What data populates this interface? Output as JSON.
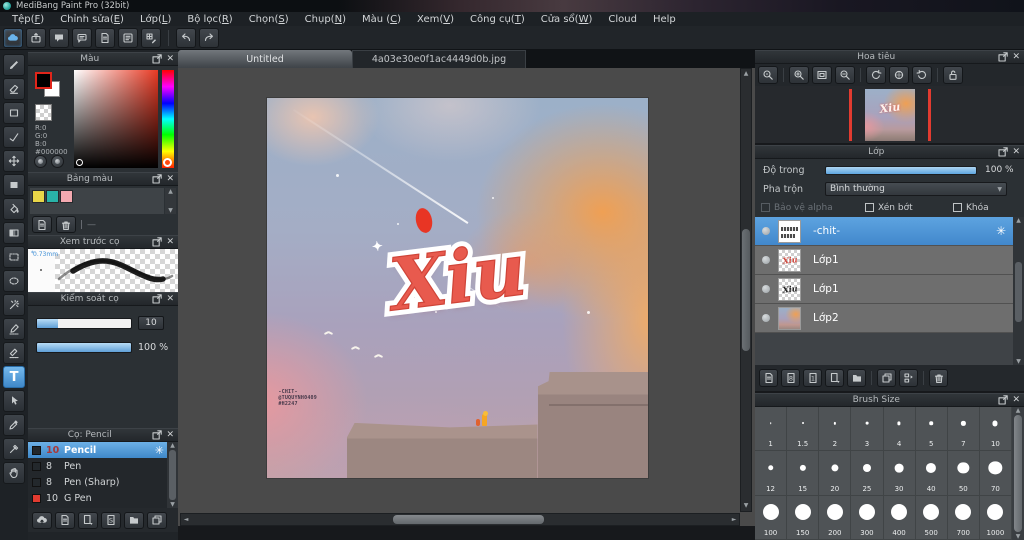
{
  "window": {
    "title": "MediBang Paint Pro (32bit)"
  },
  "menu_bar": {
    "items": [
      "Tệp(F)",
      "Chỉnh sửa(E)",
      "Lớp(L)",
      "Bộ lọc(R)",
      "Chọn(S)",
      "Chụp(N)",
      "Màu (C)",
      "Xem(V)",
      "Công cụ(T)",
      "Cửa sổ(W)",
      "Cloud",
      "Help"
    ]
  },
  "toolbar": {
    "buttons": [
      {
        "name": "cloud-sync-button",
        "icon": "cloud",
        "accent": true
      },
      {
        "name": "export-button",
        "icon": "export"
      },
      {
        "name": "comment-button",
        "icon": "comment"
      },
      {
        "name": "chat-button",
        "icon": "chat"
      },
      {
        "name": "document-button",
        "icon": "doc"
      },
      {
        "name": "material-list-button",
        "icon": "list"
      },
      {
        "name": "grid-edit-button",
        "icon": "gridpen"
      }
    ],
    "history": [
      {
        "name": "undo-button",
        "icon": "undo"
      },
      {
        "name": "redo-button",
        "icon": "redo"
      }
    ]
  },
  "tool_strip": [
    {
      "name": "brush-tool",
      "icon": "brush"
    },
    {
      "name": "eraser-tool",
      "icon": "eraser"
    },
    {
      "name": "shape-brush-tool",
      "icon": "rect"
    },
    {
      "name": "snap-tool",
      "icon": "check"
    },
    {
      "name": "move-tool",
      "icon": "move"
    },
    {
      "name": "fill-shape-tool",
      "icon": "fillrect"
    },
    {
      "name": "bucket-tool",
      "icon": "bucket"
    },
    {
      "name": "gradient-tool",
      "icon": "gradient"
    },
    {
      "name": "select-tool",
      "icon": "select"
    },
    {
      "name": "lasso-tool",
      "icon": "lasso"
    },
    {
      "name": "magic-wand-tool",
      "icon": "wand"
    },
    {
      "name": "select-pen-tool",
      "icon": "selpen"
    },
    {
      "name": "select-eraser-tool",
      "icon": "seleraser"
    },
    {
      "name": "text-tool",
      "icon": "text",
      "active": true
    },
    {
      "name": "operation-tool",
      "icon": "cursor"
    },
    {
      "name": "eyedropper-tool",
      "icon": "dropper"
    },
    {
      "name": "divide-tool",
      "icon": "dividepen"
    },
    {
      "name": "hand-tool",
      "icon": "hand"
    }
  ],
  "color_panel": {
    "title": "Màu",
    "r": "R:0",
    "g": "G:0",
    "b": "B:0",
    "hex": "#000000",
    "foreground": "#000000",
    "background": "#ffffff"
  },
  "palette_panel": {
    "title": "Bảng màu",
    "swatches": [
      "#e9d648",
      "#29b3a8",
      "#f4a9b0"
    ]
  },
  "brush_preview_panel": {
    "title": "Xem trước cọ",
    "size_label": "0.73mm"
  },
  "brush_control_panel": {
    "title": "Kiểm soát cọ",
    "size_value": "10",
    "size_fill_pct": 22,
    "opacity_value": "100 %",
    "opacity_fill_pct": 100
  },
  "brush_list_panel": {
    "title": "Cọ: Pencil",
    "brushes": [
      {
        "size": "10",
        "name": "Pencil",
        "selected": true,
        "swatch": "#23282c",
        "size_color": "#a83838"
      },
      {
        "size": "8",
        "name": "Pen",
        "swatch": "#23282c",
        "size_color": "#d2d5d7"
      },
      {
        "size": "8",
        "name": "Pen (Sharp)",
        "swatch": "#23282c",
        "size_color": "#d2d5d7"
      },
      {
        "size": "10",
        "name": "G Pen",
        "swatch": "#e23b30",
        "size_color": "#d2d5d7"
      }
    ],
    "buttons": [
      {
        "name": "brush-cloud-upload-button",
        "icon": "cloudup"
      },
      {
        "name": "brush-new-button",
        "icon": "doc"
      },
      {
        "name": "brush-new-menu-button",
        "icon": "docdd"
      },
      {
        "name": "brush-script-button",
        "icon": "docS"
      },
      {
        "name": "brush-folder-button",
        "icon": "folder"
      },
      {
        "name": "brush-duplicate-button",
        "icon": "dup"
      }
    ]
  },
  "canvas_tabs": [
    {
      "label": "Untitled"
    },
    {
      "label": "4a03e30e0f1ac4449d0b.jpg"
    }
  ],
  "artwork": {
    "title_text": "Xiu",
    "sparkle": "✦",
    "signature_lines": [
      "-CHIT-",
      "@TUQUYNH0409",
      "#H2247"
    ]
  },
  "navigator_panel": {
    "title": "Hoa tiêu",
    "buttons": [
      {
        "name": "zoom-ratio-button",
        "icon": "zoom"
      },
      {
        "name": "zoom-in-button",
        "icon": "zoomin"
      },
      {
        "name": "zoom-fit-button",
        "icon": "fit"
      },
      {
        "name": "zoom-out-button",
        "icon": "zoomout"
      },
      {
        "name": "rotate-ccw-button",
        "icon": "rotccw"
      },
      {
        "name": "rotate-reset-button",
        "icon": "rotreset"
      },
      {
        "name": "rotate-cw-button",
        "icon": "rotcw"
      },
      {
        "name": "lock-button",
        "icon": "unlock"
      }
    ]
  },
  "layers_panel": {
    "title": "Lớp",
    "opacity_label": "Độ trong",
    "opacity_value": "100 %",
    "blend_label": "Pha trộn",
    "blend_value": "Bình thường",
    "checkboxes": [
      {
        "label": "Bảo vệ alpha",
        "disabled": true
      },
      {
        "label": "Xén bớt",
        "disabled": false
      },
      {
        "label": "Khóa",
        "disabled": false
      }
    ],
    "layers": [
      {
        "name": "-chit-",
        "selected": true,
        "thumb": "text"
      },
      {
        "name": "Lớp1",
        "thumb": "xiu-red"
      },
      {
        "name": "Lớp1",
        "thumb": "xiu-black"
      },
      {
        "name": "Lớp2",
        "thumb": "art"
      }
    ],
    "buttons": [
      {
        "name": "new-layer-button",
        "icon": "doc"
      },
      {
        "name": "new-8bit-layer-button",
        "icon": "doc8"
      },
      {
        "name": "new-1bit-layer-button",
        "icon": "doc1"
      },
      {
        "name": "add-layer-menu-button",
        "icon": "docdd"
      },
      {
        "name": "layer-folder-button",
        "icon": "folder"
      },
      {
        "name": "duplicate-layer-button",
        "icon": "dup"
      },
      {
        "name": "merge-layer-button",
        "icon": "merge"
      },
      {
        "name": "delete-layer-button",
        "icon": "trash"
      }
    ]
  },
  "brush_size_panel": {
    "title": "Brush Size",
    "sizes": [
      "1",
      "1.5",
      "2",
      "3",
      "4",
      "5",
      "7",
      "10",
      "12",
      "15",
      "20",
      "25",
      "30",
      "40",
      "50",
      "70",
      "100",
      "150",
      "200",
      "300",
      "400",
      "500",
      "700",
      "1000"
    ]
  },
  "colors": {
    "accent": "#4f97d7",
    "selection": "#4288cc",
    "fg_border": "#e0251a",
    "red_guide": "#e23b30"
  }
}
